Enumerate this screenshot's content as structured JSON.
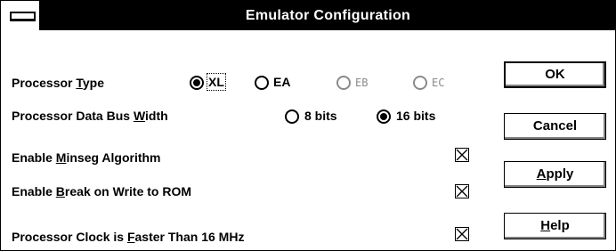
{
  "window": {
    "title": "Emulator Configuration"
  },
  "processor_type": {
    "label_pre": "Processor ",
    "label_accel": "T",
    "label_post": "ype",
    "options": [
      {
        "label": "XL",
        "selected": true,
        "enabled": true
      },
      {
        "label": "EA",
        "selected": false,
        "enabled": true
      },
      {
        "label": "EB",
        "selected": false,
        "enabled": false
      },
      {
        "label": "EC",
        "selected": false,
        "enabled": false
      }
    ]
  },
  "data_bus_width": {
    "label_pre": "Processor Data Bus ",
    "label_accel": "W",
    "label_post": "idth",
    "options": [
      {
        "label": "8 bits",
        "selected": false
      },
      {
        "label": "16 bits",
        "selected": true
      }
    ]
  },
  "checkboxes": [
    {
      "pre": "Enable ",
      "accel": "M",
      "post": "inseg Algorithm",
      "checked": true
    },
    {
      "pre": "Enable ",
      "accel": "B",
      "post": "reak on Write to ROM",
      "checked": true
    },
    {
      "pre": "Processor Clock is ",
      "accel": "F",
      "post": "aster Than 16 MHz",
      "checked": true
    }
  ],
  "buttons": {
    "ok": {
      "label": "OK"
    },
    "cancel": {
      "label": "Cancel"
    },
    "apply": {
      "pre": "",
      "accel": "A",
      "post": "pply"
    },
    "help": {
      "pre": "",
      "accel": "H",
      "post": "elp"
    }
  }
}
